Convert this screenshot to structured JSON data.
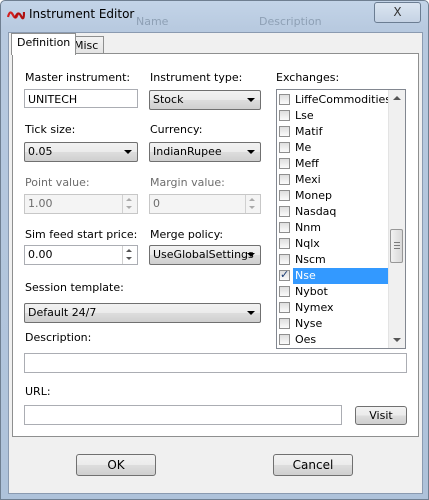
{
  "window": {
    "title": "Instrument Editor",
    "ghost_name": "Name",
    "ghost_description": "Description",
    "close_symbol": "X"
  },
  "tabs": [
    {
      "label": "Definition",
      "active": true
    },
    {
      "label": "Misc",
      "active": false
    }
  ],
  "master_instrument": {
    "label": "Master instrument:",
    "value": "UNITECH"
  },
  "instrument_type": {
    "label": "Instrument type:",
    "value": "Stock"
  },
  "tick_size": {
    "label": "Tick size:",
    "value": "0.05"
  },
  "currency": {
    "label": "Currency:",
    "value": "IndianRupee"
  },
  "point_value": {
    "label": "Point value:",
    "value": "1.00"
  },
  "margin_value": {
    "label": "Margin value:",
    "value": "0"
  },
  "sim_feed_start_price": {
    "label": "Sim feed start price:",
    "value": "0.00"
  },
  "merge_policy": {
    "label": "Merge policy:",
    "value": "UseGlobalSettings"
  },
  "session_template": {
    "label": "Session template:",
    "value": "Default 24/7"
  },
  "description": {
    "label": "Description:",
    "value": ""
  },
  "url": {
    "label": "URL:",
    "value": ""
  },
  "exchanges": {
    "label": "Exchanges:",
    "items": [
      {
        "name": "LiffeCommodities",
        "checked": false,
        "selected": false
      },
      {
        "name": "Lse",
        "checked": false,
        "selected": false
      },
      {
        "name": "Matif",
        "checked": false,
        "selected": false
      },
      {
        "name": "Me",
        "checked": false,
        "selected": false
      },
      {
        "name": "Meff",
        "checked": false,
        "selected": false
      },
      {
        "name": "Mexi",
        "checked": false,
        "selected": false
      },
      {
        "name": "Monep",
        "checked": false,
        "selected": false
      },
      {
        "name": "Nasdaq",
        "checked": false,
        "selected": false
      },
      {
        "name": "Nnm",
        "checked": false,
        "selected": false
      },
      {
        "name": "Nqlx",
        "checked": false,
        "selected": false
      },
      {
        "name": "Nscm",
        "checked": false,
        "selected": false
      },
      {
        "name": "Nse",
        "checked": true,
        "selected": true
      },
      {
        "name": "Nybot",
        "checked": false,
        "selected": false
      },
      {
        "name": "Nymex",
        "checked": false,
        "selected": false
      },
      {
        "name": "Nyse",
        "checked": false,
        "selected": false
      },
      {
        "name": "Oes",
        "checked": false,
        "selected": false
      }
    ]
  },
  "buttons": {
    "visit": "Visit",
    "ok": "OK",
    "cancel": "Cancel"
  },
  "colors": {
    "selection": "#3399ff",
    "window_frame": "#b7c9df"
  }
}
